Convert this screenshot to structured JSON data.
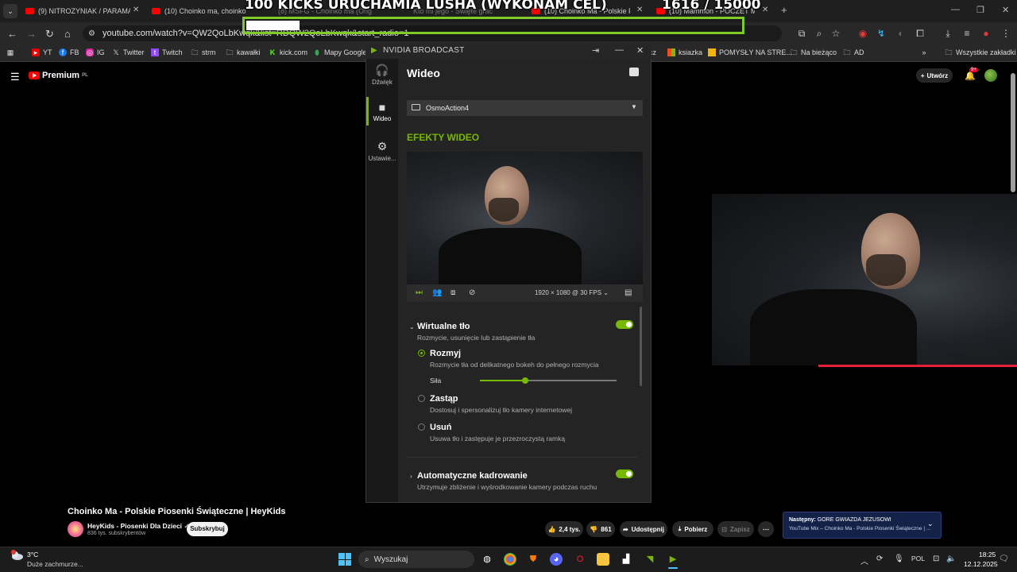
{
  "browser": {
    "tabs": [
      {
        "label": "(9) NITROZYNIAK / PARAMAXIL"
      },
      {
        "label": "(10) Choinko ma, choinko ma"
      },
      {
        "label": "(8) MSFG - Choinko ma (Orig"
      },
      {
        "label": "Kto mi jego - Święte grać"
      },
      {
        "label": "(10) Choinko Ma - Polskie Piose"
      },
      {
        "label": "(10) Mammon - POCZET MEGO"
      }
    ],
    "new_tab": "+",
    "url": "youtube.com/watch?v=QW2QoLbKwqk&list=RDQW2QoLbKwqk&start_radio=1",
    "bookmarks": [
      {
        "label": "YT"
      },
      {
        "label": "FB"
      },
      {
        "label": "IG"
      },
      {
        "label": "Twitter"
      },
      {
        "label": "Twitch"
      },
      {
        "label": "strm"
      },
      {
        "label": "kawałki"
      },
      {
        "label": "kick.com"
      },
      {
        "label": "Mapy Google"
      }
    ],
    "bookmarks_right": [
      {
        "label": "ksiazka"
      },
      {
        "label": "POMYSŁY NA STRE..."
      },
      {
        "label": "Na bieżąco"
      },
      {
        "label": "AD"
      }
    ],
    "bookmark_partial": "cz",
    "all_bookmarks": "Wszystkie zakładki"
  },
  "overlay": {
    "title": "100 KICKS URUCHAMIA LUSHA (WYKONAM CEL)",
    "count": "1616 / 15000",
    "progress": 0.1077,
    "accent": "#7ecb2a"
  },
  "youtube": {
    "premium_label": "Premium",
    "premium_region": "PL",
    "create_label": "Utwórz",
    "notif_count": "9+",
    "video_title": "Choinko Ma - Polskie Piosenki Świąteczne | HeyKids",
    "channel_name": "HeyKids - Piosenki Dla Dzieci",
    "channel_subs": "836 tys. subskrybentów",
    "subscribe_label": "Subskrybuj",
    "likes": "2,4 tys.",
    "dislikes": "861",
    "share_label": "Udostępnij",
    "download_label": "Pobierz",
    "save_label": "Zapisz",
    "next_prefix": "Następny:",
    "next_title": "GORE GWIAZDA JEZUSOWI",
    "next_sub": "YouTube Mix – Choinko Ma - Polskie Piosenki Świąteczne | ...",
    "progress_color": "#e5203b"
  },
  "nvidia": {
    "app_title": "NVIDIA BROADCAST",
    "sidebar": [
      {
        "label": "Dźwięk",
        "icon": "headset-icon"
      },
      {
        "label": "Wideo",
        "icon": "camera-icon"
      },
      {
        "label": "Ustawie...",
        "icon": "gear-icon"
      }
    ],
    "page_title": "Wideo",
    "device": "OsmoAction4",
    "section_title": "EFEKTY WIDEO",
    "resolution": "1920 × 1080 @ 30 FPS",
    "bg_effect": {
      "title": "Wirtualne tło",
      "subtitle": "Rozmycie, usunięcie lub zastąpienie tła",
      "enabled": true,
      "options": [
        {
          "title": "Rozmyj",
          "desc": "Rozmycie tła od delikatnego bokeh do pełnego rozmycia",
          "selected": true
        },
        {
          "title": "Zastąp",
          "desc": "Dostosuj i spersonalizuj tło kamery internetowej",
          "selected": false
        },
        {
          "title": "Usuń",
          "desc": "Usuwa tło i zastępuje je przezroczystą ramką",
          "selected": false
        }
      ],
      "strength_label": "Siła",
      "strength": 0.33
    },
    "autoframe": {
      "title": "Automatyczne kadrowanie",
      "subtitle": "Utrzymuje zbliżenie i wyśrodkowanie kamery podczas ruchu",
      "enabled": true
    },
    "accent": "#76b900"
  },
  "taskbar": {
    "weather_temp": "3°C",
    "weather_desc": "Duże zachmurze...",
    "search_placeholder": "Wyszukaj",
    "lang": "POL",
    "time": "18:25",
    "date": "12.12.2025"
  }
}
